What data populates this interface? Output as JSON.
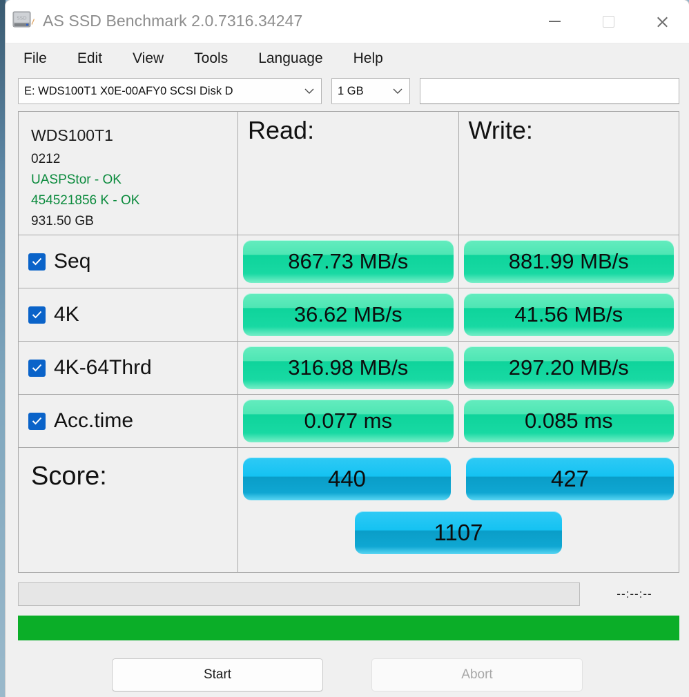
{
  "window": {
    "title": "AS SSD Benchmark 2.0.7316.34247",
    "icon": "ssd-drive-icon",
    "controls": {
      "minimize": "minimize-icon",
      "maximize": "maximize-icon",
      "close": "close-icon"
    }
  },
  "menu": {
    "items": [
      {
        "label": "File"
      },
      {
        "label": "Edit"
      },
      {
        "label": "View"
      },
      {
        "label": "Tools"
      },
      {
        "label": "Language"
      },
      {
        "label": "Help"
      }
    ]
  },
  "toolbar": {
    "drive_select": {
      "value": "E: WDS100T1 X0E-00AFY0 SCSI Disk D",
      "chevron": "chevron-down-icon"
    },
    "size_select": {
      "value": "1 GB",
      "chevron": "chevron-down-icon"
    },
    "log_field": {
      "value": "",
      "placeholder": ""
    }
  },
  "drive_info": {
    "model": "WDS100T1",
    "firmware": "0212",
    "driver_status": "UASPStor - OK",
    "alignment_status": "454521856 K - OK",
    "capacity": "931.50 GB"
  },
  "columns": {
    "read_header": "Read:",
    "write_header": "Write:"
  },
  "tests": [
    {
      "name": "Seq",
      "checked": true,
      "read": "867.73 MB/s",
      "write": "881.99 MB/s"
    },
    {
      "name": "4K",
      "checked": true,
      "read": "36.62 MB/s",
      "write": "41.56 MB/s"
    },
    {
      "name": "4K-64Thrd",
      "checked": true,
      "read": "316.98 MB/s",
      "write": "297.20 MB/s"
    },
    {
      "name": "Acc.time",
      "checked": true,
      "read": "0.077 ms",
      "write": "0.085 ms"
    }
  ],
  "score": {
    "label": "Score:",
    "read": "440",
    "write": "427",
    "total": "1107"
  },
  "status": {
    "message": "",
    "timer": "--:--:--",
    "progress_percent": 100
  },
  "actions": {
    "start_label": "Start",
    "abort_label": "Abort"
  },
  "colors": {
    "accent_green": "#0ed49b",
    "accent_blue": "#14c2f2",
    "progress_green": "#0bae28",
    "status_ok_text": "#0a8a3c",
    "checkbox_blue": "#0a63c9"
  }
}
